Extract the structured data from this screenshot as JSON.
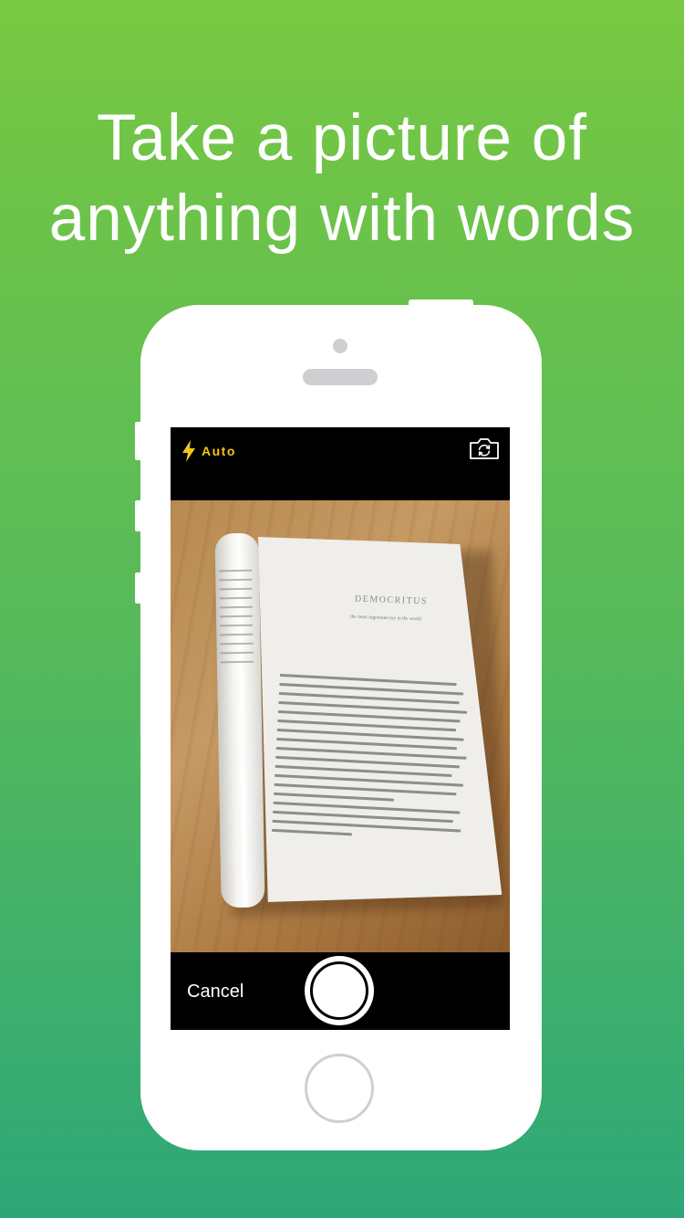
{
  "headline": {
    "line1": "Take a picture of",
    "line2": "anything with words"
  },
  "camera": {
    "flash_icon": "lightning-bolt-icon",
    "flash_label": "Auto",
    "flip_icon": "camera-flip-icon",
    "cancel_label": "Cancel",
    "shutter_icon": "shutter-button"
  },
  "book_page": {
    "title": "DEMOCRITUS",
    "subtitle": "the most ingenious toy in the world"
  },
  "colors": {
    "accent_flash": "#f5c518",
    "background_top": "#78c841",
    "background_bottom": "#2ea778"
  }
}
